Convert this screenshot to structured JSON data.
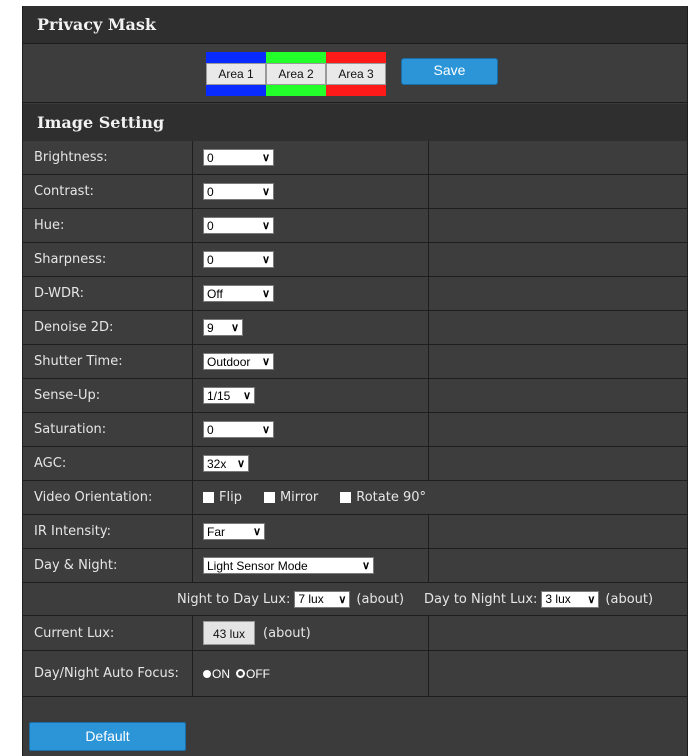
{
  "privacy_mask": {
    "title": "Privacy Mask",
    "areas": [
      {
        "label": "Area 1",
        "color": "#0a2bff"
      },
      {
        "label": "Area 2",
        "color": "#22ff2a"
      },
      {
        "label": "Area 3",
        "color": "#ff1a1a"
      }
    ],
    "save_label": "Save"
  },
  "image_setting": {
    "title": "Image Setting",
    "rows": {
      "brightness": {
        "label": "Brightness:",
        "value": "0"
      },
      "contrast": {
        "label": "Contrast:",
        "value": "0"
      },
      "hue": {
        "label": "Hue:",
        "value": "0"
      },
      "sharpness": {
        "label": "Sharpness:",
        "value": "0"
      },
      "dwdr": {
        "label": "D-WDR:",
        "value": "Off"
      },
      "denoise": {
        "label": "Denoise 2D:",
        "value": "9"
      },
      "shutter": {
        "label": "Shutter Time:",
        "value": "Outdoor"
      },
      "senseup": {
        "label": "Sense-Up:",
        "value": "1/15"
      },
      "saturation": {
        "label": "Saturation:",
        "value": "0"
      },
      "agc": {
        "label": "AGC:",
        "value": "32x"
      },
      "orientation": {
        "label": "Video Orientation:",
        "flip": "Flip",
        "mirror": "Mirror",
        "rotate": "Rotate 90°"
      },
      "ir": {
        "label": "IR Intensity:",
        "value": "Far"
      },
      "daynight": {
        "label": "Day & Night:",
        "value": "Light Sensor Mode"
      },
      "lux_thresholds": {
        "n2d_label": "Night to Day Lux:",
        "n2d_value": "7 lux",
        "n2d_suffix": "(about)",
        "d2n_label": "Day to Night Lux:",
        "d2n_value": "3 lux",
        "d2n_suffix": "(about)"
      },
      "current_lux": {
        "label": "Current Lux:",
        "value": "43 lux",
        "suffix": "(about)"
      },
      "autofocus": {
        "label": "Day/Night Auto Focus:",
        "on": "ON",
        "off": "OFF"
      }
    }
  },
  "footer": {
    "default_label": "Default"
  }
}
